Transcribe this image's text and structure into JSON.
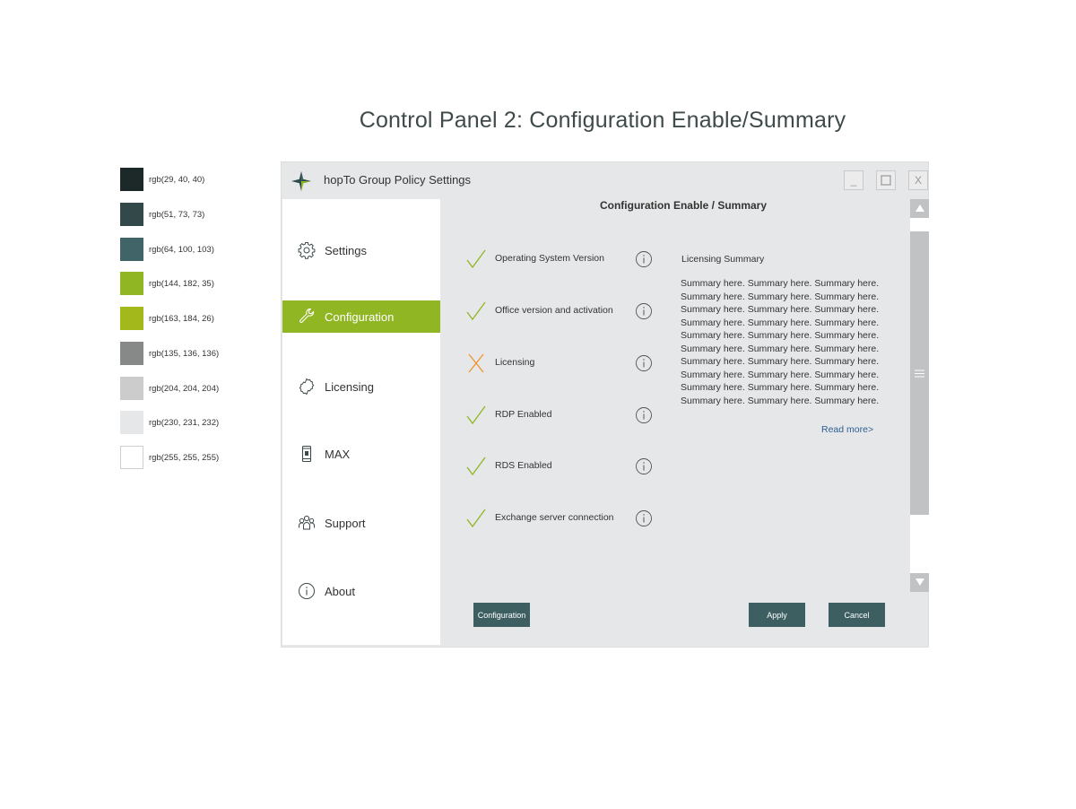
{
  "page": {
    "title": "Control Panel 2: Configuration Enable/Summary"
  },
  "palette": [
    {
      "color": "#1d2828",
      "label": "rgb(29, 40, 40)"
    },
    {
      "color": "#334949",
      "label": "rgb(51, 73, 73)"
    },
    {
      "color": "#406467",
      "label": "rgb(64, 100, 103)"
    },
    {
      "color": "#90b623",
      "label": "rgb(144, 182, 35)"
    },
    {
      "color": "#a3b81a",
      "label": "rgb(163, 184, 26)"
    },
    {
      "color": "#878888",
      "label": "rgb(135, 136, 136)"
    },
    {
      "color": "#cccccc",
      "label": "rgb(204, 204, 204)"
    },
    {
      "color": "#e6e7e8",
      "label": "rgb(230, 231, 232)"
    },
    {
      "color": "#ffffff",
      "label": "rgb(255, 255, 255)"
    }
  ],
  "window": {
    "title": "hopTo Group Policy Settings",
    "minimize_label": "_",
    "close_label": "X"
  },
  "sidebar": {
    "items": [
      {
        "label": "Settings",
        "icon": "gear-icon"
      },
      {
        "label": "Configuration",
        "icon": "wrench-icon",
        "active": true
      },
      {
        "label": "Licensing",
        "icon": "badge-icon"
      },
      {
        "label": "MAX",
        "icon": "mobile-icon"
      },
      {
        "label": "Support",
        "icon": "people-icon"
      },
      {
        "label": "About",
        "icon": "info-icon"
      }
    ]
  },
  "main": {
    "title": "Configuration Enable / Summary",
    "checks": [
      {
        "label": "Operating System Version",
        "status": "ok"
      },
      {
        "label": "Office version and activation",
        "status": "ok"
      },
      {
        "label": "Licensing",
        "status": "fail"
      },
      {
        "label": "RDP Enabled",
        "status": "ok"
      },
      {
        "label": "RDS Enabled",
        "status": "ok"
      },
      {
        "label": "Exchange server connection",
        "status": "ok"
      }
    ],
    "summary": {
      "title": "Licensing Summary",
      "lines": [
        "Summary here. Summary here. Summary here.",
        "Summary here. Summary here. Summary here.",
        "Summary here. Summary here. Summary here.",
        "Summary here. Summary here. Summary here.",
        "Summary here. Summary here. Summary here.",
        "Summary here. Summary here. Summary here.",
        "Summary here. Summary here. Summary here.",
        "Summary here. Summary here. Summary here.",
        "Summary here. Summary here. Summary here.",
        "Summary here. Summary here. Summary here."
      ],
      "read_more": "Read more>"
    }
  },
  "footer": {
    "configuration_label": "Configuration",
    "apply_label": "Apply",
    "cancel_label": "Cancel"
  },
  "colors": {
    "accent_green": "#90b623",
    "button_teal": "#3d5f61",
    "fail_orange": "#f0922c"
  }
}
